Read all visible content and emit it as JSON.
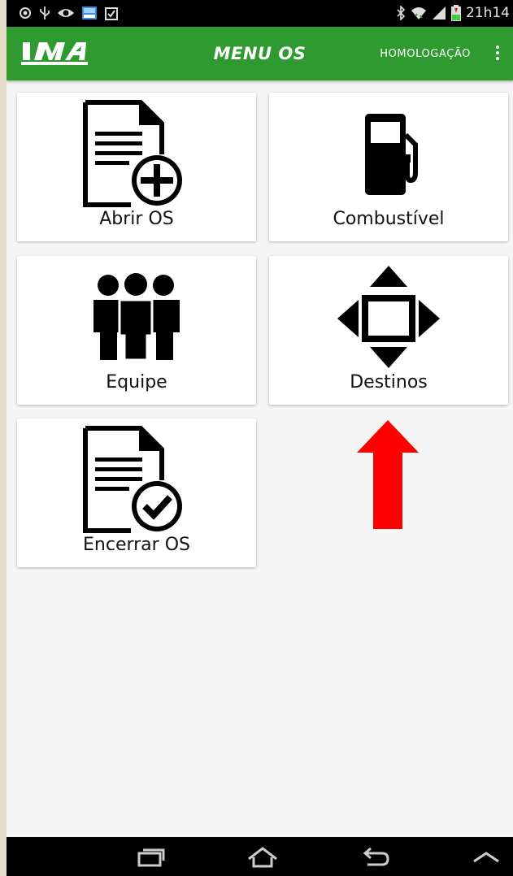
{
  "status_bar": {
    "left_icons": [
      "location-icon",
      "usb-icon",
      "eye-icon",
      "image-icon",
      "clipboard-icon"
    ],
    "right_icons": [
      "bluetooth-icon",
      "wifi-icon",
      "signal-icon",
      "battery-icon"
    ],
    "time": "21h14"
  },
  "app_bar": {
    "logo_text": "IMA",
    "title": "MENU OS",
    "environment": "HOMOLOGAÇÃO",
    "menu_icon": "overflow-menu-icon"
  },
  "menu": [
    {
      "label": "Abrir OS",
      "icon": "document-add-icon"
    },
    {
      "label": "Combustível",
      "icon": "fuel-pump-icon"
    },
    {
      "label": "Equipe",
      "icon": "team-icon"
    },
    {
      "label": "Destinos",
      "icon": "move-arrows-icon"
    },
    {
      "label": "Encerrar OS",
      "icon": "document-check-icon"
    }
  ],
  "annotation": {
    "icon": "red-arrow-up-icon",
    "color": "#ff0000"
  },
  "nav_bar": [
    "recent-apps-icon",
    "home-icon",
    "back-icon",
    "up-chevron-icon"
  ],
  "colors": {
    "app_bar": "#2e9a30",
    "background": "#f5f5f5",
    "nav_bar": "#000000"
  }
}
